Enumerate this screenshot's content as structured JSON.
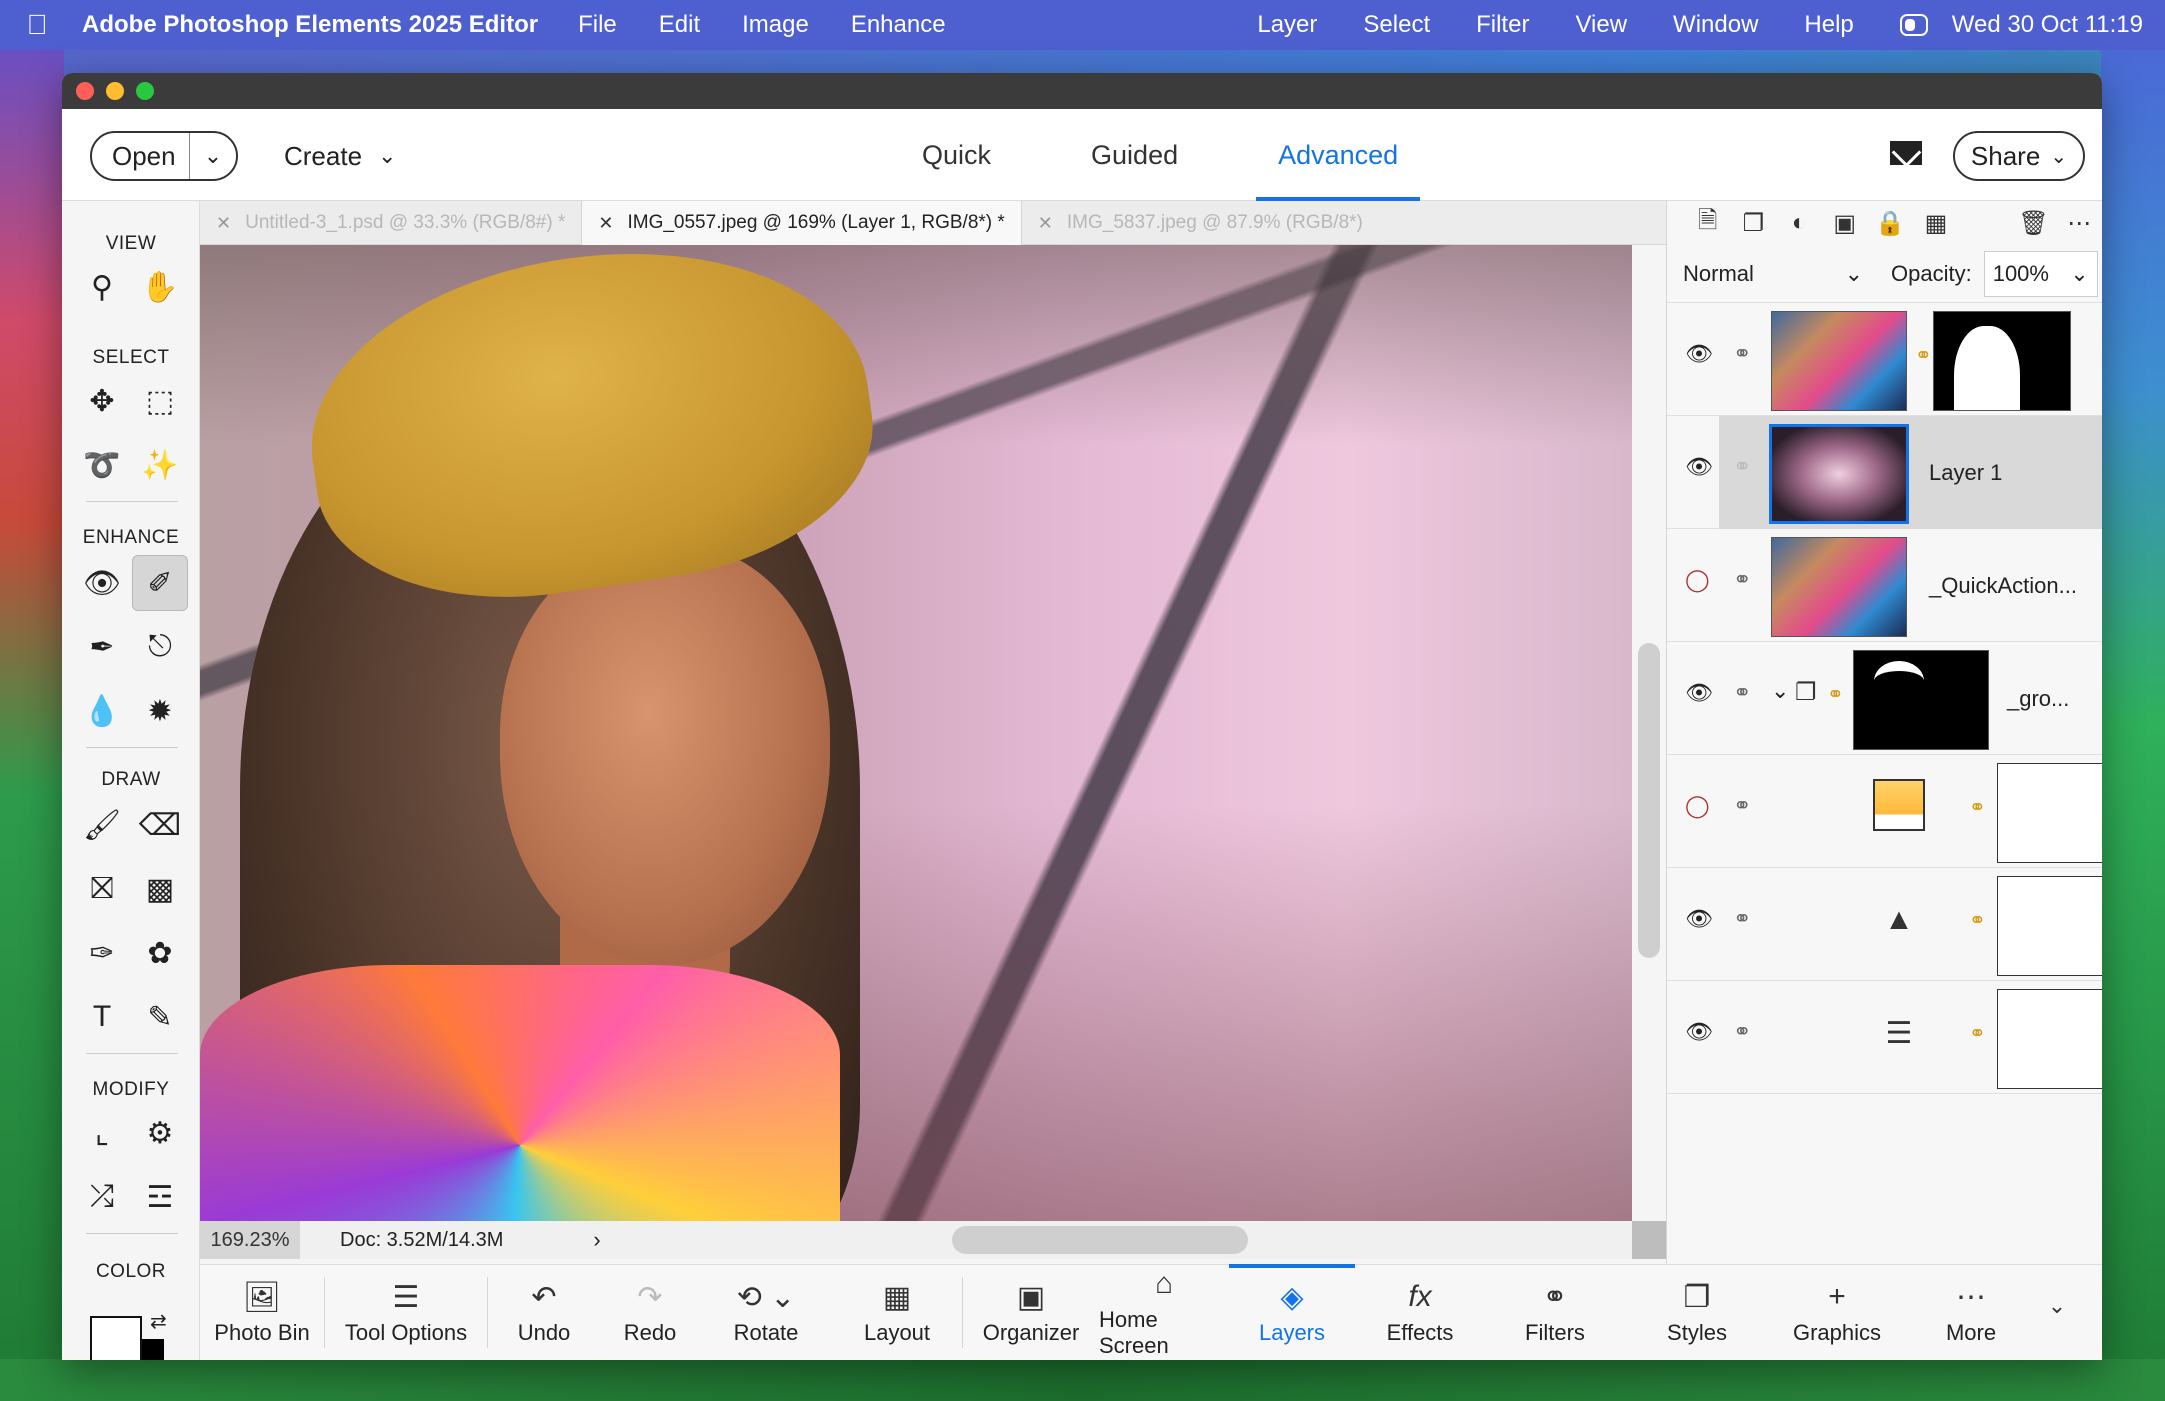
{
  "menubar": {
    "app_name": "Adobe Photoshop Elements 2025 Editor",
    "menus_left": [
      "File",
      "Edit",
      "Image",
      "Enhance"
    ],
    "menus_right": [
      "Layer",
      "Select",
      "Filter",
      "View",
      "Window",
      "Help"
    ],
    "clock": "Wed 30 Oct  11:19"
  },
  "topbar": {
    "open_label": "Open",
    "create_label": "Create",
    "modes": [
      "Quick",
      "Guided",
      "Advanced"
    ],
    "active_mode": "Advanced",
    "share_label": "Share"
  },
  "toolbox": {
    "sections": {
      "view": "VIEW",
      "select": "SELECT",
      "enhance": "ENHANCE",
      "draw": "DRAW",
      "modify": "MODIFY",
      "color": "COLOR"
    }
  },
  "doc_tabs": [
    {
      "label": "Untitled-3_1.psd @ 33.3% (RGB/8#) *",
      "active": false
    },
    {
      "label": "IMG_0557.jpeg @ 169% (Layer 1, RGB/8*) *",
      "active": true
    },
    {
      "label": "IMG_5837.jpeg @ 87.9% (RGB/8*)",
      "active": false
    }
  ],
  "status": {
    "zoom": "169.23%",
    "doc_size": "Doc: 3.52M/14.3M"
  },
  "layers_panel": {
    "blend_mode": "Normal",
    "opacity_label": "Opacity:",
    "opacity_value": "100%",
    "layers": [
      {
        "name": "",
        "visible": true
      },
      {
        "name": "Layer 1",
        "visible": true,
        "selected": true
      },
      {
        "name": "_QuickAction...",
        "visible": false
      },
      {
        "name": "_gro...",
        "visible": true
      },
      {
        "name": "",
        "visible": false
      },
      {
        "name": "",
        "visible": true
      },
      {
        "name": "",
        "visible": true
      }
    ]
  },
  "taskbar": {
    "photo_bin": "Photo Bin",
    "tool_options": "Tool Options",
    "undo": "Undo",
    "redo": "Redo",
    "rotate": "Rotate",
    "layout": "Layout",
    "organizer": "Organizer",
    "home_screen": "Home Screen",
    "layers": "Layers",
    "effects": "Effects",
    "filters": "Filters",
    "styles": "Styles",
    "graphics": "Graphics",
    "more": "More"
  },
  "colors": {
    "accent": "#1473e6",
    "menubar": "#4e5fd0"
  }
}
